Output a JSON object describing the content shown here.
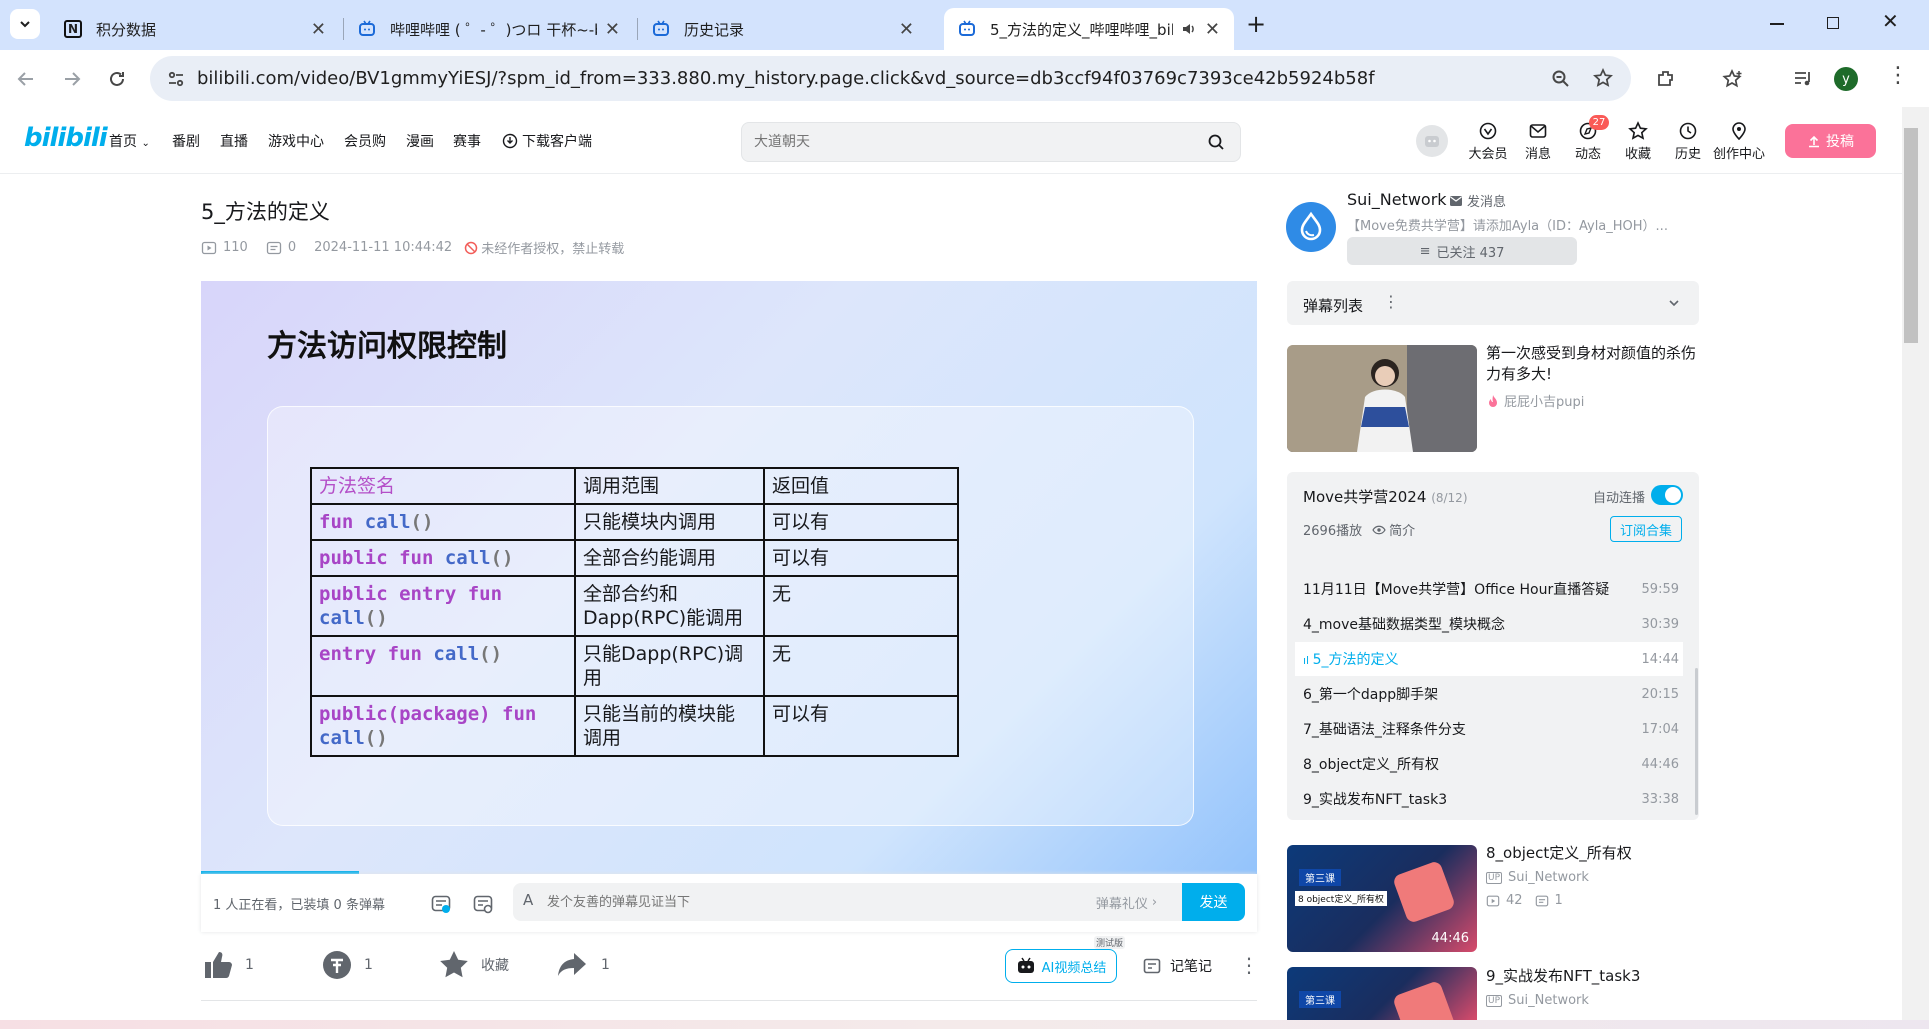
{
  "browser": {
    "tabs": [
      {
        "title": "积分数据",
        "icon": "notion-icon"
      },
      {
        "title": "哔哩哔哩 ( ゜- ゜)つロ 干杯~-bil",
        "icon": "bilibili-tv-icon"
      },
      {
        "title": "历史记录",
        "icon": "bilibili-tv-icon"
      },
      {
        "title": "5_方法的定义_哔哩哔哩_bili",
        "icon": "bilibili-tv-icon",
        "audio": true
      }
    ],
    "url": "bilibili.com/video/BV1gmmyYiESJ/?spm_id_from=333.880.my_history.page.click&vd_source=db3ccf94f03769c7393ce42b5924b58f",
    "profile_initial": "y"
  },
  "header": {
    "logo": "bilibili",
    "nav": [
      "首页",
      "番剧",
      "直播",
      "游戏中心",
      "会员购",
      "漫画",
      "赛事",
      "下载客户端"
    ],
    "search_placeholder": "大道朝天",
    "icons": [
      {
        "label": "大会员",
        "icon": "vip-icon"
      },
      {
        "label": "消息",
        "icon": "message-icon"
      },
      {
        "label": "动态",
        "icon": "dynamic-icon",
        "badge": "27"
      },
      {
        "label": "收藏",
        "icon": "star-icon"
      },
      {
        "label": "历史",
        "icon": "history-icon"
      },
      {
        "label": "创作中心",
        "icon": "creator-icon"
      }
    ],
    "upload_label": "投稿"
  },
  "video": {
    "title": "5_方法的定义",
    "views": "110",
    "danmaku_count": "0",
    "date": "2024-11-11 10:44:42",
    "copyright": "未经作者授权，禁止转载"
  },
  "slide": {
    "title": "方法访问权限控制",
    "headers": [
      "方法签名",
      "调用范围",
      "返回值"
    ],
    "rows": [
      {
        "sig": [
          [
            "kw",
            "fun "
          ],
          [
            "fn",
            "call"
          ],
          [
            "pr",
            "()"
          ]
        ],
        "scope": "只能模块内调用",
        "ret": "可以有"
      },
      {
        "sig": [
          [
            "kw",
            "public fun "
          ],
          [
            "fn",
            "call"
          ],
          [
            "pr",
            "()"
          ]
        ],
        "scope": "全部合约能调用",
        "ret": "可以有"
      },
      {
        "sig": [
          [
            "kw",
            "public entry fun"
          ],
          [
            "br",
            ""
          ],
          [
            "fn",
            "call"
          ],
          [
            "pr",
            "()"
          ]
        ],
        "scope": "全部合约和\nDapp(RPC)能调用",
        "ret": "无"
      },
      {
        "sig": [
          [
            "kw",
            "entry fun "
          ],
          [
            "fn",
            "call"
          ],
          [
            "pr",
            "()"
          ]
        ],
        "scope": "只能Dapp(RPC)调\n用",
        "ret": "无"
      },
      {
        "sig": [
          [
            "kw",
            "public(package) fun"
          ],
          [
            "br",
            ""
          ],
          [
            "fn",
            "call"
          ],
          [
            "pr",
            "()"
          ]
        ],
        "scope": "只能当前的模块能\n调用",
        "ret": "可以有"
      }
    ],
    "playback_progress": 0.15
  },
  "danmaku_bar": {
    "watching": "1 人正在看，已装填 0 条弹幕",
    "placeholder": "发个友善的弹幕见证当下",
    "etiquette": "弹幕礼仪",
    "send": "发送"
  },
  "actions": {
    "like": "1",
    "coin": "1",
    "favorite": "收藏",
    "share": "1",
    "ai_summary": "AI视频总结",
    "ai_tag": "测试版",
    "notes": "记笔记"
  },
  "uploader": {
    "name": "Sui_Network",
    "message": "发消息",
    "desc": "【Move免费共学营】请添加Ayla（ID：Ayla_HOH）...",
    "follow": "已关注 437"
  },
  "danmaku_list_label": "弹幕列表",
  "ad": {
    "title": "第一次感受到身材对颜值的杀伤力有多大!",
    "up": "屁屁小吉pupi"
  },
  "collection": {
    "title": "Move共学营2024",
    "progress": "(8/12)",
    "autoplay": "自动连播",
    "plays": "2696播放",
    "intro": "简介",
    "subscribe": "订阅合集",
    "episodes": [
      {
        "title": "11月11日【Move共学营】Office Hour直播答疑",
        "dur": "59:59"
      },
      {
        "title": "4_move基础数据类型_模块概念",
        "dur": "30:39"
      },
      {
        "title": "5_方法的定义",
        "dur": "14:44",
        "current": true
      },
      {
        "title": "6_第一个dapp脚手架",
        "dur": "20:15"
      },
      {
        "title": "7_基础语法_注释条件分支",
        "dur": "17:04"
      },
      {
        "title": "8_object定义_所有权",
        "dur": "44:46"
      },
      {
        "title": "9_实战发布NFT_task3",
        "dur": "33:38"
      }
    ]
  },
  "recommendations": [
    {
      "title": "8_object定义_所有权",
      "up": "Sui_Network",
      "views": "42",
      "danmaku": "1",
      "duration": "44:46",
      "thumb_caption": "8 object定义_所有权",
      "thumb_badge": "第三课"
    },
    {
      "title": "9_实战发布NFT_task3",
      "up": "Sui_Network",
      "thumb_badge": "第三课"
    }
  ],
  "colors": {
    "accent": "#00aeec",
    "pink": "#fb7299",
    "chrome": "#d3e3fd"
  }
}
